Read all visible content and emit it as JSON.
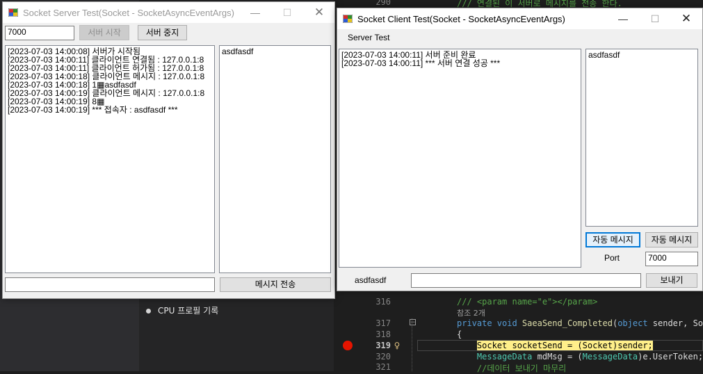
{
  "server_window": {
    "title": "Socket Server Test(Socket - SocketAsyncEventArgs)",
    "port_value": "7000",
    "start_button": "서버 시작",
    "stop_button": "서버 중지",
    "log_lines": [
      "[2023-07-03 14:00:08] 서버가 시작됨",
      "[2023-07-03 14:00:11] 클라이언트 연결됨 : 127.0.0.1:8",
      "[2023-07-03 14:00:11] 클라이언트 허가됨 : 127.0.0.1:8",
      "[2023-07-03 14:00:18] 클라이언트 메시지 : 127.0.0.1:8",
      "[2023-07-03 14:00:18] 1▦asdfasdf",
      "[2023-07-03 14:00:19] 클라이언트 메시지 : 127.0.0.1:8",
      "[2023-07-03 14:00:19] 8▦",
      "[2023-07-03 14:00:19] *** 접속자 : asdfasdf ***"
    ],
    "user_list": [
      "asdfasdf"
    ],
    "message_input": "",
    "send_button": "메시지 전송"
  },
  "client_window": {
    "title": "Socket Client Test(Socket - SocketAsyncEventArgs)",
    "menu": [
      "Server Test"
    ],
    "log_lines": [
      "[2023-07-03 14:00:11] 서버 준비 완료",
      "[2023-07-03 14:00:11] *** 서버 연결 성공 ***"
    ],
    "user_list": [
      "asdfasdf"
    ],
    "auto_message_button_1": "자동 메시지",
    "auto_message_button_2": "자동 메시지",
    "port_label": "Port",
    "port_value": "7000",
    "user_label": "asdfasdf",
    "message_input": "",
    "send_button": "보내기"
  },
  "background": {
    "cpu_profile_label": "CPU 프로필 기록",
    "code_lines": [
      {
        "n": "290",
        "parts": [
          {
            "t": "/// 연결된 이 서버로 메시지를 전송 한다.",
            "c": "c-com"
          }
        ]
      },
      {
        "n": "316",
        "parts": [
          {
            "t": "/// ",
            "c": "c-com"
          },
          {
            "t": "<param name=\"e\"></param>",
            "c": "c-com"
          }
        ]
      },
      {
        "n": "",
        "parts": [
          {
            "t": "참조 2개",
            "c": "c-ref"
          }
        ]
      },
      {
        "n": "317",
        "parts": [
          {
            "t": "private void ",
            "c": "c-kw"
          },
          {
            "t": "SaeaSend_Completed",
            "c": "c-meth"
          },
          {
            "t": "(",
            "c": ""
          },
          {
            "t": "object",
            "c": "c-kw"
          },
          {
            "t": " sender, Sock",
            "c": ""
          }
        ]
      },
      {
        "n": "318",
        "parts": [
          {
            "t": "{",
            "c": ""
          }
        ]
      },
      {
        "n": "319",
        "parts": [
          {
            "t": "    ",
            "c": ""
          },
          {
            "t": "Socket socketSend = (Socket)sender;",
            "c": "hl"
          }
        ]
      },
      {
        "n": "320",
        "parts": [
          {
            "t": "    ",
            "c": ""
          },
          {
            "t": "MessageData",
            "c": "c-type"
          },
          {
            "t": " mdMsg = (",
            "c": ""
          },
          {
            "t": "MessageData",
            "c": "c-type"
          },
          {
            "t": ")e.UserToken;",
            "c": ""
          }
        ]
      },
      {
        "n": "321",
        "parts": [
          {
            "t": "    //데이터 보내기 마무리",
            "c": "c-com"
          }
        ]
      }
    ]
  },
  "colors": {
    "accent": "#0078d7",
    "breakpoint": "#e51400",
    "highlight": "#ffef8a"
  }
}
